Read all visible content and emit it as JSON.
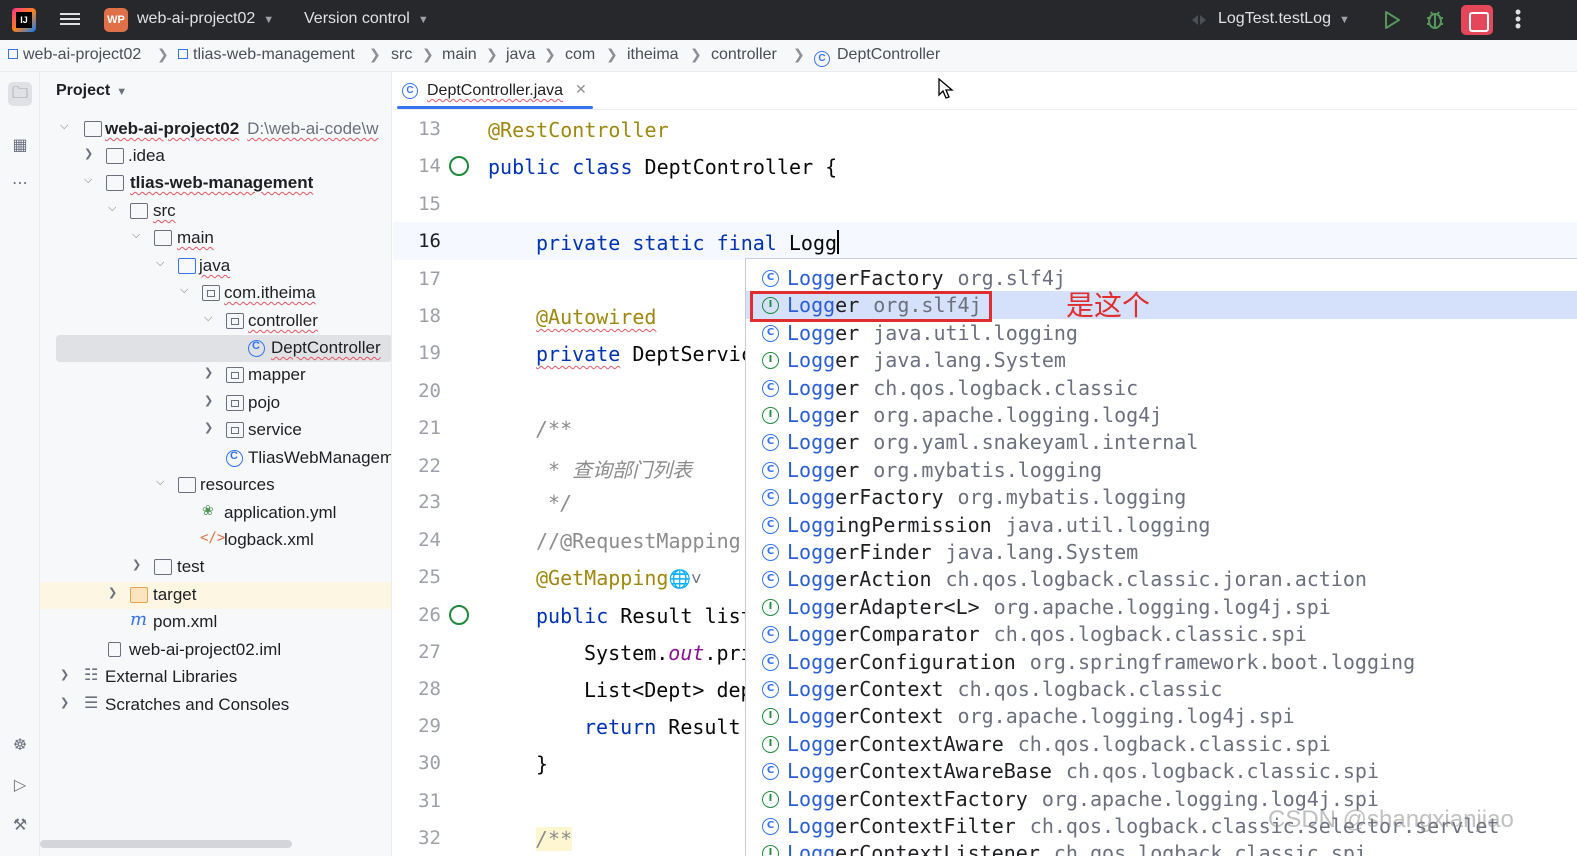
{
  "titlebar": {
    "project_badge": "WP",
    "project_name": "web-ai-project02",
    "version_control": "Version control",
    "run_config": "LogTest.testLog"
  },
  "breadcrumb": [
    "web-ai-project02",
    "tlias-web-management",
    "src",
    "main",
    "java",
    "com",
    "itheima",
    "controller",
    "DeptController"
  ],
  "project_panel": {
    "title": "Project",
    "root_path": "D:\\web-ai-code\\w",
    "tree": [
      {
        "label": "web-ai-project02",
        "bold": true
      },
      {
        "label": ".idea"
      },
      {
        "label": "tlias-web-management",
        "bold": true
      },
      {
        "label": "src"
      },
      {
        "label": "main"
      },
      {
        "label": "java"
      },
      {
        "label": "com.itheima"
      },
      {
        "label": "controller"
      },
      {
        "label": "DeptController"
      },
      {
        "label": "mapper"
      },
      {
        "label": "pojo"
      },
      {
        "label": "service"
      },
      {
        "label": "TliasWebManagem"
      },
      {
        "label": "resources"
      },
      {
        "label": "application.yml"
      },
      {
        "label": "logback.xml"
      },
      {
        "label": "test"
      },
      {
        "label": "target"
      },
      {
        "label": "pom.xml"
      },
      {
        "label": "web-ai-project02.iml"
      },
      {
        "label": "External Libraries"
      },
      {
        "label": "Scratches and Consoles"
      }
    ]
  },
  "editor": {
    "tab": "DeptController.java",
    "line_numbers": [
      "13",
      "14",
      "15",
      "16",
      "17",
      "18",
      "19",
      "20",
      "21",
      "22",
      "23",
      "24",
      "25",
      "26",
      "27",
      "28",
      "29",
      "30",
      "31",
      "32"
    ],
    "code": {
      "l13": "@RestController",
      "l14_kw": "public class",
      "l14_rest": " DeptController {",
      "l16_kw": "private static final",
      "l16_rest": " Logg",
      "l18": "@Autowired",
      "l19_kw": "private",
      "l19_rest": " DeptServic",
      "l21": "/**",
      "l22": " * 查询部门列表",
      "l23": " */",
      "l24": "//@RequestMapping(",
      "l25": "@GetMapping",
      "l26_kw": "public",
      "l26_rest": " Result list",
      "l27_a": "System.",
      "l27_field": "out",
      "l27_b": ".pri",
      "l28": "List<Dept> dep",
      "l29_kw": "return",
      "l29_rest": " Result.",
      "l30": "}",
      "l32": "/**"
    }
  },
  "completion": {
    "items": [
      {
        "match": "Logg",
        "rest": "erFactory",
        "pkg": "org.slf4j",
        "kind": "C"
      },
      {
        "match": "Logg",
        "rest": "er",
        "pkg": "org.slf4j",
        "kind": "I"
      },
      {
        "match": "Logg",
        "rest": "er",
        "pkg": "java.util.logging",
        "kind": "C"
      },
      {
        "match": "Logg",
        "rest": "er",
        "pkg": "java.lang.System",
        "kind": "I"
      },
      {
        "match": "Logg",
        "rest": "er",
        "pkg": "ch.qos.logback.classic",
        "kind": "C"
      },
      {
        "match": "Logg",
        "rest": "er",
        "pkg": "org.apache.logging.log4j",
        "kind": "I"
      },
      {
        "match": "Logg",
        "rest": "er",
        "pkg": "org.yaml.snakeyaml.internal",
        "kind": "C"
      },
      {
        "match": "Logg",
        "rest": "er",
        "pkg": "org.mybatis.logging",
        "kind": "C"
      },
      {
        "match": "Logg",
        "rest": "erFactory",
        "pkg": "org.mybatis.logging",
        "kind": "C"
      },
      {
        "match": "Logg",
        "rest": "ingPermission",
        "pkg": "java.util.logging",
        "kind": "C"
      },
      {
        "match": "Logg",
        "rest": "erFinder",
        "pkg": "java.lang.System",
        "kind": "C"
      },
      {
        "match": "Logg",
        "rest": "erAction",
        "pkg": "ch.qos.logback.classic.joran.action",
        "kind": "C"
      },
      {
        "match": "Logg",
        "rest": "erAdapter<L>",
        "pkg": "org.apache.logging.log4j.spi",
        "kind": "I"
      },
      {
        "match": "Logg",
        "rest": "erComparator",
        "pkg": "ch.qos.logback.classic.spi",
        "kind": "C"
      },
      {
        "match": "Logg",
        "rest": "erConfiguration",
        "pkg": "org.springframework.boot.logging",
        "kind": "C"
      },
      {
        "match": "Logg",
        "rest": "erContext",
        "pkg": "ch.qos.logback.classic",
        "kind": "C"
      },
      {
        "match": "Logg",
        "rest": "erContext",
        "pkg": "org.apache.logging.log4j.spi",
        "kind": "I"
      },
      {
        "match": "Logg",
        "rest": "erContextAware",
        "pkg": "ch.qos.logback.classic.spi",
        "kind": "I"
      },
      {
        "match": "Logg",
        "rest": "erContextAwareBase",
        "pkg": "ch.qos.logback.classic.spi",
        "kind": "C"
      },
      {
        "match": "Logg",
        "rest": "erContextFactory",
        "pkg": "org.apache.logging.log4j.spi",
        "kind": "I"
      },
      {
        "match": "Logg",
        "rest": "erContextFilter",
        "pkg": "ch.qos.logback.classic.selector.servlet",
        "kind": "C"
      },
      {
        "match": "Logg",
        "rest": "erContextListener",
        "pkg": "ch.qos.logback.classic.spi",
        "kind": "I"
      }
    ],
    "selected_index": 1
  },
  "annotation_text": "是这个",
  "watermark": "CSDN @shangxianjiao",
  "colors": {
    "accent": "#3574f0",
    "highlight_box": "#e02d2d",
    "selection": "#d5e1fa"
  }
}
